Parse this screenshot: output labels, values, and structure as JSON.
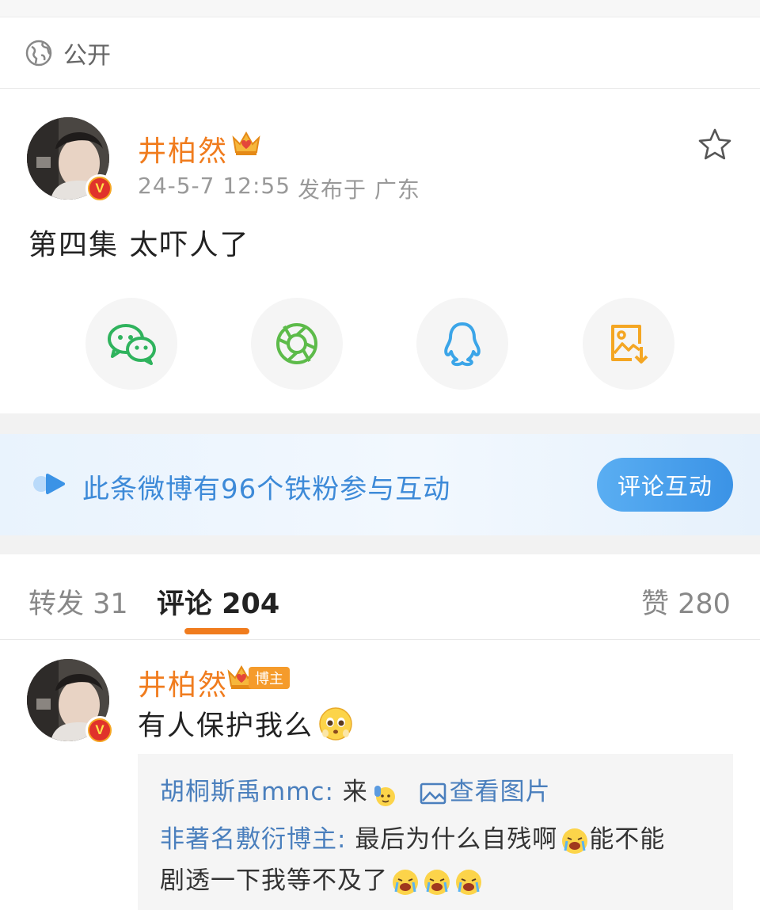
{
  "visibility": {
    "icon": "globe-icon",
    "label": "公开"
  },
  "post": {
    "author": "井柏然",
    "time": "24-5-7 12:55",
    "location": "发布于 广东",
    "text": "第四集 太吓人了",
    "share_buttons": [
      {
        "name": "wechat",
        "icon": "wechat-icon",
        "color": "#2fb35d"
      },
      {
        "name": "moments",
        "icon": "moments-icon",
        "color": "#5dbb4a"
      },
      {
        "name": "qq",
        "icon": "qq-icon",
        "color": "#3ba5e8"
      },
      {
        "name": "save-image",
        "icon": "save-image-icon",
        "color": "#f4a623"
      }
    ]
  },
  "fans_banner": {
    "text": "此条微博有96个铁粉参与互动",
    "button": "评论互动"
  },
  "tabs": {
    "repost": "转发 31",
    "comment": "评论 204",
    "like": "赞 280"
  },
  "comment": {
    "author": "井柏然",
    "tag": "博主",
    "text": "有人保护我么",
    "emoji": "pleading-face-emoji",
    "replies": [
      {
        "user": "胡桐斯禹mmc:",
        "text": "来",
        "emoji": "raised-hand-emoji",
        "link": "查看图片"
      },
      {
        "user": "非著名敷衍博主:",
        "text": "最后为什么自残啊",
        "emoji": "crying-face-emoji",
        "text2": "能不能",
        "line2": "剧透一下我等不及了"
      }
    ]
  },
  "colors": {
    "brand_orange": "#f07c1e",
    "link_blue": "#4a7fbd",
    "banner_blue": "#3d8ad8"
  }
}
